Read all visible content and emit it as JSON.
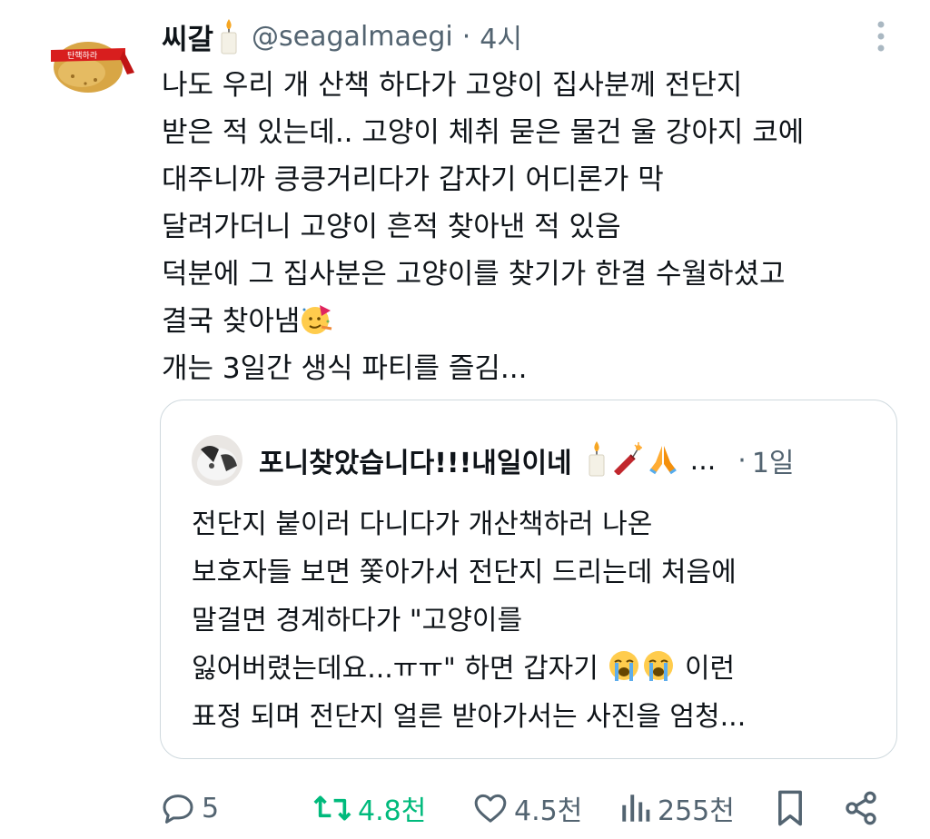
{
  "tweet": {
    "author_name": "씨갈",
    "author_emoji": "candle-icon",
    "handle": "@seagalmaegi",
    "separator": "·",
    "time": "4시",
    "avatar_label": "탄핵하라",
    "text": "나도 우리 개 산책 하다가 고양이 집사분께 전단지\n받은 적 있는데.. 고양이 체취 묻은 물건 울 강아지 코에\n대주니까 킁킁거리다가 갑자기 어디론가 막\n달려가더니 고양이 흔적 찾아낸 적 있음\n덕분에 그 집사분은 고양이를 찾기가 한결 수월하셨고\n결국 찾아냄",
    "text_emoji": "partying-face-icon",
    "text_tail": "개는 3일간 생식 파티를 즐김..."
  },
  "quote": {
    "author_name": "포니찾았습니다!!!내일이네",
    "emojis": [
      "candle-icon",
      "firecracker-icon",
      "folded-hands-icon"
    ],
    "ellipsis": "...",
    "separator": "·",
    "time": "1일",
    "text_part1": "전단지 붙이러 다니다가 개산책하러 나온\n보호자들 보면 쫓아가서 전단지 드리는데 처음에\n말걸면 경계하다가 \"고양이를\n잃어버렸는데요...ㅠㅠ\" 하면 갑자기 ",
    "text_emojis": [
      "loudly-crying-face-icon",
      "loudly-crying-face-icon"
    ],
    "text_part2": " 이런\n표정 되며 전단지 얼른 받아가서는 사진을 엄청..."
  },
  "actions": {
    "reply_count": "5",
    "retweet_count": "4.8천",
    "like_count": "4.5천",
    "view_count": "255천"
  },
  "colors": {
    "text": "#0f1419",
    "secondary": "#536471",
    "retweet": "#00ba7c",
    "border": "#cfd9de"
  }
}
